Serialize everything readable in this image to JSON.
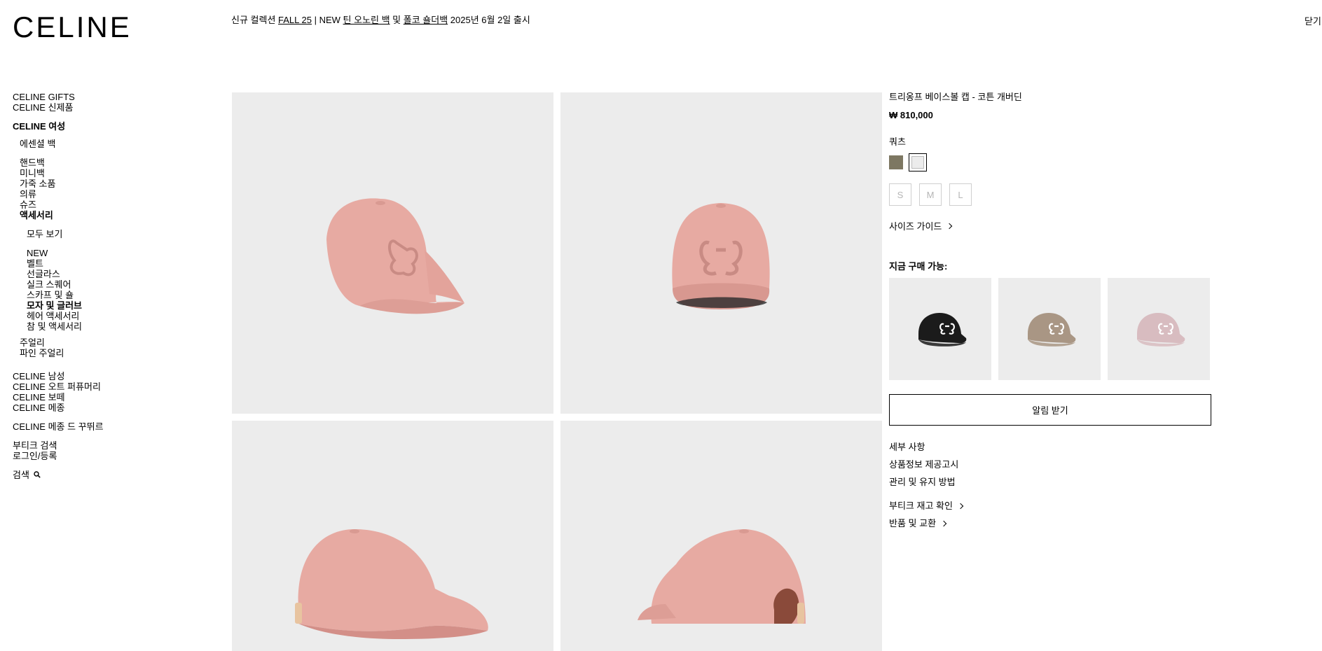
{
  "brand": {
    "logo": "CELINE"
  },
  "announcement": {
    "prefix": "신규 컬렉션 ",
    "link1": "FALL 25",
    "mid": " | NEW ",
    "link2": "틴 오노린 백",
    "and": " 및 ",
    "link3": "폴코 숄더백",
    "suffix": " 2025년 6월 2일 출시"
  },
  "header": {
    "close_label": "닫기"
  },
  "sidebar": {
    "gifts": "CELINE GIFTS",
    "new_arrivals": "CELINE 신제품",
    "women": "CELINE 여성",
    "essential_bags": "에센셜 백",
    "women_items": [
      "핸드백",
      "미니백",
      "가죽 소품",
      "의류",
      "슈즈"
    ],
    "accessories": "액세서리",
    "view_all": "모두 보기",
    "accessory_items": [
      "NEW",
      "벨트",
      "선글라스",
      "실크 스퀘어",
      "스카프 및 숄"
    ],
    "hats_gloves": "모자 및 글러브",
    "accessory_items_after": [
      "헤어 액세서리",
      "참 및 액세서리"
    ],
    "jewelry": "주얼리",
    "fine_jewelry": "파인 주얼리",
    "men": "CELINE 남성",
    "haute_parfumerie": "CELINE 오트 퍼퓨머리",
    "beaute": "CELINE 보떼",
    "maison": "CELINE 메종",
    "maison_couture": "CELINE 메종 드 꾸뛰르",
    "boutique_search": "부티크 검색",
    "login": "로그인/등록",
    "search": "검색"
  },
  "product": {
    "name": "트리옹프 베이스볼 캡 - 코튼 개버딘",
    "price": "₩ 810,000",
    "color_label": "쿼츠",
    "swatches": [
      {
        "color": "#7d7762",
        "selected": false
      },
      {
        "color": "#ececec",
        "selected": true
      }
    ],
    "sizes": [
      "S",
      "M",
      "L"
    ],
    "size_guide": "사이즈 가이드",
    "available_now": "지금 구매 가능:",
    "thumbs": [
      {
        "cap": "#1b1b1b",
        "logo": "#ffffff"
      },
      {
        "cap": "#a99684",
        "logo": "#ffffff"
      },
      {
        "cap": "#d8bcc0",
        "logo": "#ffffff"
      }
    ],
    "notify_button": "알림 받기",
    "details": "세부 사항",
    "product_info": "상품정보 제공고시",
    "care": "관리 및 유지 방법",
    "stock_check": "부티크 재고 확인",
    "returns": "반품 및 교환"
  },
  "colors": {
    "cap_pink": "#e7aaa2",
    "cap_pink_dark": "#c98b84",
    "tile_bg": "#ececec"
  }
}
